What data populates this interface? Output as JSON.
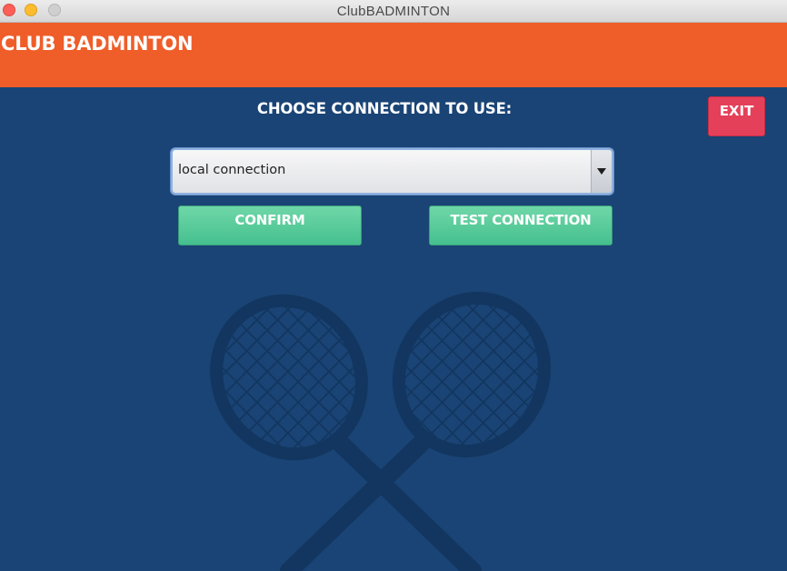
{
  "window": {
    "title": "ClubBADMINTON",
    "buttons": [
      "close",
      "minimize",
      "zoom"
    ]
  },
  "header": {
    "title": "CLUB BADMINTON",
    "background_color": "#ef5d29"
  },
  "main": {
    "background_color": "#1a4475",
    "prompt": "CHOOSE CONNECTION TO USE:",
    "connection_select": {
      "selected": "local connection"
    },
    "buttons": {
      "confirm": "CONFIRM",
      "test_connection": "TEST CONNECTION",
      "exit": "EXIT"
    },
    "colors": {
      "confirm_button": "#52c796",
      "exit_button": "#e5405a"
    },
    "background_art": "crossed-badminton-rackets-icon"
  }
}
